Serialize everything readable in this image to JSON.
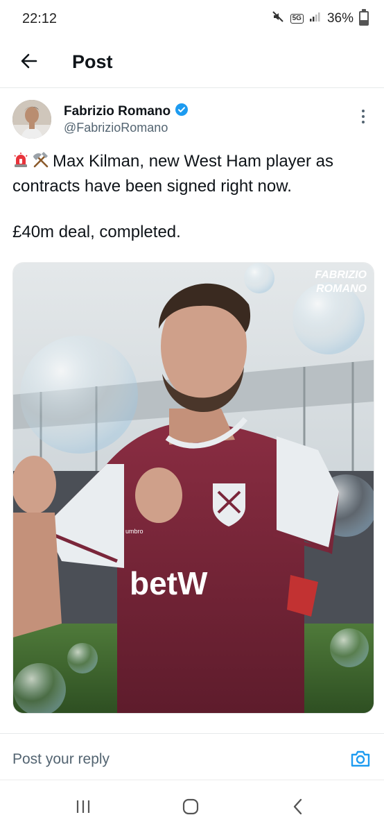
{
  "status_bar": {
    "time": "22:12",
    "network_badge": "5G",
    "battery_percent": "36%",
    "battery_level": 0.36,
    "icons": [
      "mute-icon",
      "5g-icon",
      "signal-icon",
      "battery-icon"
    ]
  },
  "header": {
    "title": "Post",
    "back_icon": "arrow-left-icon"
  },
  "post": {
    "author": {
      "name": "Fabrizio Romano",
      "handle": "@FabrizioRomano",
      "verified": true,
      "verified_color": "#1d9bf0"
    },
    "text_lines": [
      "Max Kilman, new West Ham player as",
      "contracts have been signed right now."
    ],
    "text_deal": "£40m deal, completed.",
    "emojis": [
      "rotating-light-icon",
      "hammer-and-pick-icon"
    ],
    "media": {
      "watermark_line1": "FABRIZIO",
      "watermark_line2": "ROMANO",
      "sponsor_text": "betW",
      "kit_brand": "umbro",
      "kit_primary": "#7a263a",
      "kit_secondary": "#e9edf0"
    }
  },
  "reply": {
    "placeholder": "Post your reply",
    "accent_color": "#1d9bf0"
  },
  "nav_bar": {
    "buttons": [
      "recents-icon",
      "home-icon",
      "back-icon"
    ]
  }
}
